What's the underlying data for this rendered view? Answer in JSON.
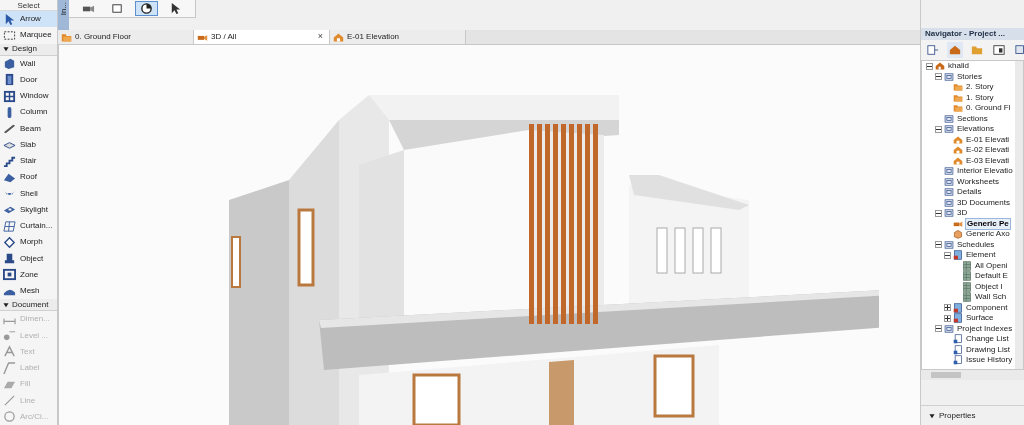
{
  "toolbox": [
    {
      "kind": "heading",
      "label": "Select"
    },
    {
      "kind": "tool",
      "label": "Arrow",
      "selected": true,
      "disabled": false
    },
    {
      "kind": "tool",
      "label": "Marquee",
      "selected": false,
      "disabled": false
    },
    {
      "kind": "section",
      "label": "Design",
      "expanded": true
    },
    {
      "kind": "tool",
      "label": "Wall",
      "selected": false,
      "disabled": false
    },
    {
      "kind": "tool",
      "label": "Door",
      "selected": false,
      "disabled": false
    },
    {
      "kind": "tool",
      "label": "Window",
      "selected": false,
      "disabled": false
    },
    {
      "kind": "tool",
      "label": "Column",
      "selected": false,
      "disabled": false
    },
    {
      "kind": "tool",
      "label": "Beam",
      "selected": false,
      "disabled": false
    },
    {
      "kind": "tool",
      "label": "Slab",
      "selected": false,
      "disabled": false
    },
    {
      "kind": "tool",
      "label": "Stair",
      "selected": false,
      "disabled": false
    },
    {
      "kind": "tool",
      "label": "Roof",
      "selected": false,
      "disabled": false
    },
    {
      "kind": "tool",
      "label": "Shell",
      "selected": false,
      "disabled": false
    },
    {
      "kind": "tool",
      "label": "Skylight",
      "selected": false,
      "disabled": false
    },
    {
      "kind": "tool",
      "label": "Curtain...",
      "selected": false,
      "disabled": false
    },
    {
      "kind": "tool",
      "label": "Morph",
      "selected": false,
      "disabled": false
    },
    {
      "kind": "tool",
      "label": "Object",
      "selected": false,
      "disabled": false
    },
    {
      "kind": "tool",
      "label": "Zone",
      "selected": false,
      "disabled": false
    },
    {
      "kind": "tool",
      "label": "Mesh",
      "selected": false,
      "disabled": false
    },
    {
      "kind": "section",
      "label": "Document",
      "expanded": true
    },
    {
      "kind": "tool",
      "label": "Dimen...",
      "selected": false,
      "disabled": true
    },
    {
      "kind": "tool",
      "label": "Level ...",
      "selected": false,
      "disabled": true
    },
    {
      "kind": "tool",
      "label": "Text",
      "selected": false,
      "disabled": true
    },
    {
      "kind": "tool",
      "label": "Label",
      "selected": false,
      "disabled": true
    },
    {
      "kind": "tool",
      "label": "Fill",
      "selected": false,
      "disabled": true
    },
    {
      "kind": "tool",
      "label": "Line",
      "selected": false,
      "disabled": true
    },
    {
      "kind": "tool",
      "label": "Arc/Ci...",
      "selected": false,
      "disabled": true
    }
  ],
  "side_tab": {
    "label": "In..."
  },
  "toolbar": [
    {
      "selected": false
    },
    {
      "selected": false
    },
    {
      "selected": true
    },
    {
      "selected": false
    }
  ],
  "tabs": [
    {
      "label": "0. Ground Floor",
      "kind": "story",
      "selected": false
    },
    {
      "label": "3D / All",
      "kind": "camera",
      "selected": true,
      "close": "×"
    },
    {
      "label": "E-01 Elevation",
      "kind": "elevation",
      "selected": false
    }
  ],
  "navigator": {
    "title": "Navigator - Project ...",
    "tree": [
      {
        "label": "khalid",
        "kind": "project",
        "expanded": true,
        "selected": false,
        "children": [
          {
            "label": "Stories",
            "kind": "view",
            "expanded": true,
            "selected": false,
            "children": [
              {
                "label": "2. Story",
                "kind": "story",
                "selected": false
              },
              {
                "label": "1. Story",
                "kind": "story",
                "selected": false
              },
              {
                "label": "0. Ground Fl",
                "kind": "story",
                "selected": false
              }
            ]
          },
          {
            "label": "Sections",
            "kind": "view",
            "selected": false
          },
          {
            "label": "Elevations",
            "kind": "view",
            "expanded": true,
            "selected": false,
            "children": [
              {
                "label": "E-01 Elevati",
                "kind": "elevation",
                "selected": false
              },
              {
                "label": "E-02 Elevati",
                "kind": "elevation",
                "selected": false
              },
              {
                "label": "E-03 Elevati",
                "kind": "elevation",
                "selected": false
              }
            ]
          },
          {
            "label": "Interior Elevatio",
            "kind": "view",
            "selected": false
          },
          {
            "label": "Worksheets",
            "kind": "view",
            "selected": false
          },
          {
            "label": "Details",
            "kind": "view",
            "selected": false
          },
          {
            "label": "3D Documents",
            "kind": "view",
            "selected": false
          },
          {
            "label": "3D",
            "kind": "view",
            "expanded": true,
            "selected": false,
            "children": [
              {
                "label": "Generic Pe",
                "kind": "camera",
                "selected": true
              },
              {
                "label": "Generic Axo",
                "kind": "box",
                "selected": false
              }
            ]
          },
          {
            "label": "Schedules",
            "kind": "view",
            "expanded": true,
            "selected": false,
            "children": [
              {
                "label": "Element",
                "kind": "schedule",
                "expanded": true,
                "selected": false,
                "children": [
                  {
                    "label": "All Openi",
                    "kind": "sheet",
                    "selected": false
                  },
                  {
                    "label": "Default E",
                    "kind": "sheet",
                    "selected": false
                  },
                  {
                    "label": "Object I",
                    "kind": "sheet",
                    "selected": false
                  },
                  {
                    "label": "Wall Sch",
                    "kind": "sheet",
                    "selected": false
                  }
                ]
              },
              {
                "label": "Component",
                "kind": "schedule",
                "expanded": false,
                "selected": false
              },
              {
                "label": "Surface",
                "kind": "schedule",
                "expanded": false,
                "selected": false
              }
            ]
          },
          {
            "label": "Project Indexes",
            "kind": "view",
            "expanded": true,
            "selected": false,
            "children": [
              {
                "label": "Change List",
                "kind": "index",
                "selected": false
              },
              {
                "label": "Drawing List",
                "kind": "index",
                "selected": false
              },
              {
                "label": "Issue History",
                "kind": "index",
                "selected": false
              }
            ]
          }
        ]
      }
    ],
    "properties": {
      "label": "Properties",
      "expanded": true
    }
  }
}
